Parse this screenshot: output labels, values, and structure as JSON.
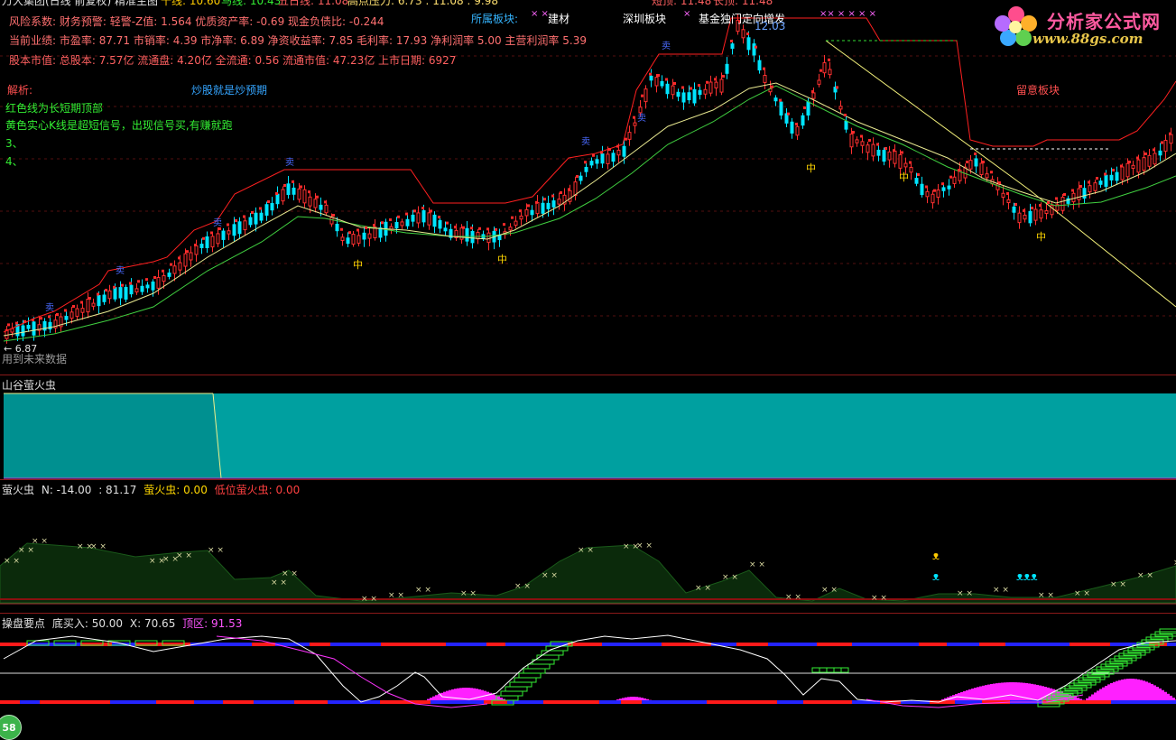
{
  "colors": {
    "red": "#ff3030",
    "teal": "#00aaaa",
    "yellow": "#ffd700",
    "green": "#33cc33",
    "cyan": "#00e5ff",
    "magenta": "#ff33ff",
    "blue_bar": "#2020ff"
  },
  "top_bar": {
    "title": "万大集团(日线 前复权) 精准主图",
    "k_label": "十线: 10.60",
    "ma_label": "马线: 10.43",
    "five_day": "五日线: 11.08",
    "pressure": "高点压力: 6.73 : 11.08 : 9.98",
    "short_term": "短顶: 11.48",
    "long_term": "长顶: 11.48"
  },
  "info_lines": {
    "risk": "风险系数: 财务预警: 轻警-Z值: 1.564 优质资产率: -0.69 现金负债比: -0.244",
    "perf": "当前业绩: 市盈率: 87.71 市销率: 4.39 市净率: 6.89 净资收益率: 7.85 毛利率: 17.93 净利润率 5.00 主营利润率 5.39",
    "cap": "股本市值: 总股本: 7.57亿 流通盘: 4.20亿 全流通: 0.56 流通市值: 47.23亿 上市日期: 6927"
  },
  "sector": {
    "label": "所属板块:",
    "s1": "建材",
    "s2": "深圳板块",
    "s3": "基金独门",
    "s4": "定向增发"
  },
  "notes": {
    "title": "解析:",
    "line1": "红色线为长短期顶部",
    "line2": "黄色实心K线是超短信号，出现信号买,有赚就跑",
    "line3": "3、",
    "line4": "4、",
    "slogan": "炒股就是炒预期",
    "watch": "留意板块",
    "peak": "12.03",
    "low": "6.87",
    "future": "用到未来数据",
    "mid_marker": "中"
  },
  "panel2": {
    "title": "山谷萤火虫"
  },
  "panel3": {
    "title": "萤火虫",
    "n": "N: -14.00",
    "v": ": 81.17",
    "yhc": "萤火虫: 0.00",
    "low": "低位萤火虫: 0.00"
  },
  "panel4": {
    "title": "操盘要点",
    "buy": "底买入: 50.00",
    "x": "X: 70.65",
    "top": "顶区: 91.53"
  },
  "logo": {
    "name": "分析家公式网",
    "url": "www.88gs.com"
  },
  "badge": "58"
}
